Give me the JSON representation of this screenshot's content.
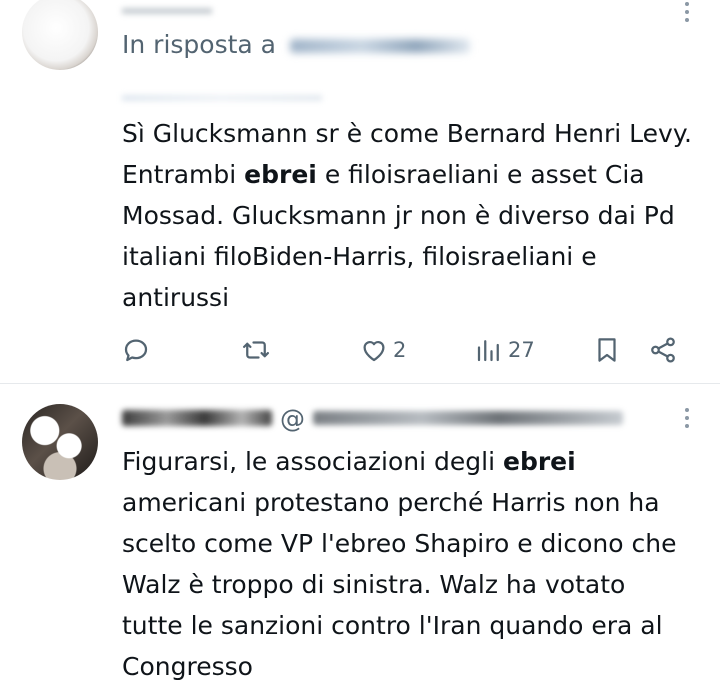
{
  "tweets": [
    {
      "reply_prefix": "In risposta a",
      "text_parts": [
        "Sì Glucksmann sr è come Bernard Henri Levy. Entrambi ",
        "ebrei",
        " e filoisraeliani e asset Cia Mossad. Glucksmann jr non è diverso dai Pd italiani filoBiden-Harris, filoisraeliani e antirussi"
      ],
      "actions": {
        "reply_count": "",
        "retweet_count": "",
        "like_count": "2",
        "views_count": "27"
      }
    },
    {
      "handle_prefix": "@",
      "text_parts": [
        "Figurarsi, le associazioni degli ",
        "ebrei",
        " americani protestano perché Harris non ha scelto come VP l'ebreo Shapiro e dicono che Walz è troppo di sinistra. Walz ha votato tutte le sanzioni contro l'Iran quando era al Congresso"
      ]
    }
  ],
  "icons": {
    "reply": "reply-icon",
    "retweet": "retweet-icon",
    "like": "heart-icon",
    "views": "views-icon",
    "bookmark": "bookmark-icon",
    "share": "share-icon",
    "more": "more-dots-icon"
  },
  "colors": {
    "text": "#0f1419",
    "secondary": "#536471",
    "divider": "#e6e9ec"
  }
}
